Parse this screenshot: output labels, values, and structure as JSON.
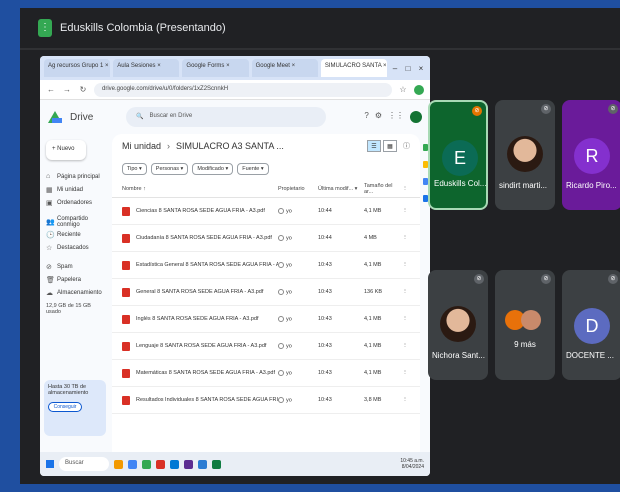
{
  "meet": {
    "title": "Eduskills Colombia (Presentando)"
  },
  "browser": {
    "tabs": [
      "Ag recursos Grupo 1 ×",
      "Aula Sesiones ×",
      "Google Forms ×",
      "Google Meet ×",
      "SIMULACRO SANTA ×"
    ],
    "url": "drive.google.com/drive/u/0/folders/1xZ2ScnnkH",
    "win_controls": [
      "–",
      "□",
      "×"
    ]
  },
  "drive": {
    "app_name": "Drive",
    "search_placeholder": "Buscar en Drive",
    "new_label": "+ Nuevo",
    "sidebar": [
      {
        "icon": "⌂",
        "label": "Página principal"
      },
      {
        "icon": "▦",
        "label": "Mi unidad"
      },
      {
        "icon": "▣",
        "label": "Ordenadores"
      },
      {
        "icon": "👥",
        "label": "Compartido conmigo"
      },
      {
        "icon": "🕒",
        "label": "Reciente"
      },
      {
        "icon": "☆",
        "label": "Destacados"
      },
      {
        "icon": "⊘",
        "label": "Spam"
      },
      {
        "icon": "🗑",
        "label": "Papelera"
      },
      {
        "icon": "☁",
        "label": "Almacenamiento"
      }
    ],
    "storage": "12,9 GB de 15 GB usado",
    "promo_text": "Hasta 30 TB de almacenamiento",
    "promo_button": "Conseguir",
    "breadcrumb": [
      "Mi unidad",
      "SIMULACRO A3 SANTA ..."
    ],
    "filters": [
      "Tipo ▾",
      "Personas ▾",
      "Modificado ▾",
      "Fuente ▾"
    ],
    "columns": {
      "name": "Nombre ↑",
      "owner": "Propietario",
      "modified": "Última modif... ▾",
      "size": "Tamaño del ar...",
      "more": "⋮"
    },
    "files": [
      {
        "name": "Ciencias 8 SANTA ROSA SEDE AGUA FRIA - A3.pdf",
        "owner": "yo",
        "modified": "10:44",
        "size": "4,1 MB"
      },
      {
        "name": "Ciudadanía 8 SANTA ROSA SEDE AGUA FRIA - A3.pdf",
        "owner": "yo",
        "modified": "10:44",
        "size": "4 MB"
      },
      {
        "name": "Estadística General 8 SANTA ROSA SEDE AGUA FRIA - A3.pdf",
        "owner": "yo",
        "modified": "10:43",
        "size": "4,1 MB"
      },
      {
        "name": "General 8 SANTA ROSA SEDE AGUA FRIA - A3.pdf",
        "owner": "yo",
        "modified": "10:43",
        "size": "136 KB"
      },
      {
        "name": "Inglés 8 SANTA ROSA SEDE AGUA FRIA - A3.pdf",
        "owner": "yo",
        "modified": "10:43",
        "size": "4,1 MB"
      },
      {
        "name": "Lenguaje 8 SANTA ROSA SEDE AGUA FRIA - A3.pdf",
        "owner": "yo",
        "modified": "10:43",
        "size": "4,1 MB"
      },
      {
        "name": "Matemáticas 8 SANTA ROSA SEDE AGUA FRIA - A3.pdf",
        "owner": "yo",
        "modified": "10:43",
        "size": "4,1 MB"
      },
      {
        "name": "Resultados Individuales 8 SANTA ROSA SEDE AGUA FRIA - A3.pdf",
        "owner": "yo",
        "modified": "10:43",
        "size": "3,8 MB"
      }
    ]
  },
  "taskbar": {
    "search": "Buscar",
    "clock_time": "10:45 a.m.",
    "clock_date": "8/04/2024"
  },
  "participants": [
    {
      "name": "Eduskills Col...",
      "initial": "E",
      "color": "#0b6b55",
      "border": "#a8dab5"
    },
    {
      "name": "sindirt marti...",
      "initial": "",
      "color": "#5f6368"
    },
    {
      "name": "Ricardo Piro...",
      "initial": "R",
      "color": "#8430ce"
    },
    {
      "name": "Nichora Sant...",
      "initial": "",
      "color": "#3c4043"
    },
    {
      "name": "",
      "initial": "",
      "color": "#3c4043",
      "more": "9 más"
    },
    {
      "name": "DOCENTE ...",
      "initial": "D",
      "color": "#5c6bc0"
    }
  ],
  "colors": {
    "screen_bg": "#1f4fa0",
    "meet_bg": "#202124",
    "drive_accent": "#0b57d0",
    "pdf_red": "#d93025"
  }
}
